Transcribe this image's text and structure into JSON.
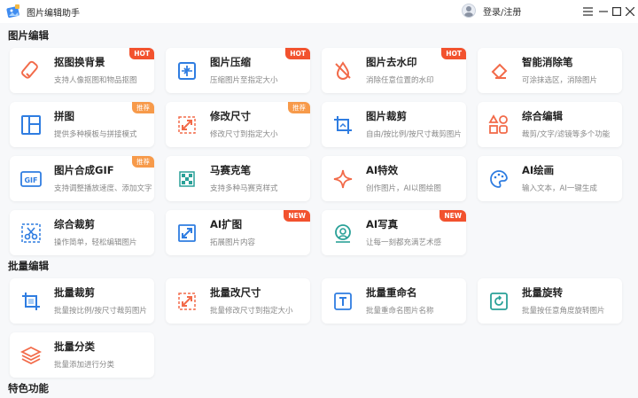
{
  "app": {
    "title": "图片编辑助手",
    "login_label": "登录/注册"
  },
  "colors": {
    "accent_blue": "#2f7de1",
    "accent_orange": "#f2522e",
    "hot_badge": "#f2522e",
    "rec_badge": "#f79a4a"
  },
  "sections": [
    {
      "title": "图片编辑",
      "cards": [
        {
          "name": "抠图换背景",
          "desc": "支持人像抠图和物品抠图",
          "badge": "HOT",
          "icon": "eraser-icon"
        },
        {
          "name": "图片压缩",
          "desc": "压缩图片至指定大小",
          "badge": "HOT",
          "icon": "compress-icon"
        },
        {
          "name": "图片去水印",
          "desc": "消除任意位置的水印",
          "badge": "HOT",
          "icon": "no-watermark-icon"
        },
        {
          "name": "智能消除笔",
          "desc": "可涂抹选区，消除图片",
          "badge": "",
          "icon": "smart-eraser-icon"
        },
        {
          "name": "拼图",
          "desc": "提供多种模板与拼接模式",
          "badge": "推荐",
          "icon": "collage-icon"
        },
        {
          "name": "修改尺寸",
          "desc": "修改尺寸到指定大小",
          "badge": "推荐",
          "icon": "resize-icon"
        },
        {
          "name": "图片裁剪",
          "desc": "自由/按比例/按尺寸裁剪图片",
          "badge": "",
          "icon": "crop-icon"
        },
        {
          "name": "综合编辑",
          "desc": "裁剪/文字/滤镜等多个功能",
          "badge": "",
          "icon": "shapes-icon"
        },
        {
          "name": "图片合成GIF",
          "desc": "支持调整播放速度、添加文字",
          "badge": "推荐",
          "icon": "gif-icon"
        },
        {
          "name": "马赛克笔",
          "desc": "支持多种马赛克样式",
          "badge": "",
          "icon": "mosaic-icon"
        },
        {
          "name": "AI特效",
          "desc": "创作图片，AI以图绘图",
          "badge": "",
          "icon": "sparkle-icon"
        },
        {
          "name": "AI绘画",
          "desc": "输入文本，AI一键生成",
          "badge": "",
          "icon": "palette-icon"
        },
        {
          "name": "综合裁剪",
          "desc": "操作简单，轻松编辑图片",
          "badge": "",
          "icon": "scissors-icon"
        },
        {
          "name": "AI扩图",
          "desc": "拓展图片内容",
          "badge": "NEW",
          "icon": "expand-icon"
        },
        {
          "name": "AI写真",
          "desc": "让每一刻都充满艺术感",
          "badge": "NEW",
          "icon": "portrait-icon"
        }
      ]
    },
    {
      "title": "批量编辑",
      "cards": [
        {
          "name": "批量裁剪",
          "desc": "批量按比例/按尺寸裁剪图片",
          "badge": "",
          "icon": "batch-crop-icon"
        },
        {
          "name": "批量改尺寸",
          "desc": "批量修改尺寸到指定大小",
          "badge": "",
          "icon": "batch-resize-icon"
        },
        {
          "name": "批量重命名",
          "desc": "批量重命名图片名称",
          "badge": "",
          "icon": "rename-icon"
        },
        {
          "name": "批量旋转",
          "desc": "批量按任意角度旋转图片",
          "badge": "",
          "icon": "rotate-icon"
        },
        {
          "name": "批量分类",
          "desc": "批量添加进行分类",
          "badge": "",
          "icon": "layers-icon"
        }
      ]
    },
    {
      "title": "特色功能",
      "cards": []
    }
  ]
}
